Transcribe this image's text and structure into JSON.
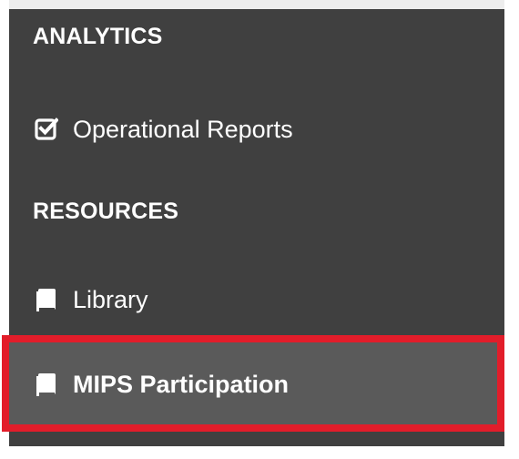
{
  "sidebar": {
    "sections": [
      {
        "header": "ANALYTICS",
        "items": [
          {
            "label": "Operational Reports",
            "icon": "checkbox-icon",
            "active": false
          }
        ]
      },
      {
        "header": "RESOURCES",
        "items": [
          {
            "label": "Library",
            "icon": "book-icon",
            "active": false
          },
          {
            "label": "MIPS Participation",
            "icon": "book-icon",
            "active": true
          }
        ]
      }
    ]
  },
  "colors": {
    "sidebar_bg": "#404040",
    "active_bg": "#5a5a5a",
    "highlight_border": "#e21d2a",
    "text": "#ffffff"
  }
}
